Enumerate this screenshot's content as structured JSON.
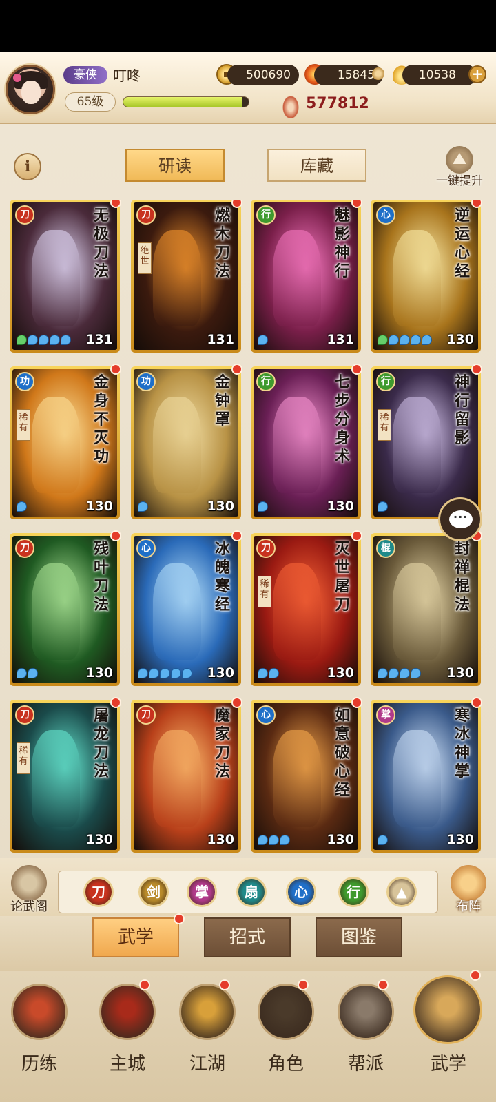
{
  "header": {
    "rank": "豪侠",
    "player_name": "叮咚",
    "level": "65级",
    "exp_fraction": 0.95,
    "copper": "500690",
    "fire": "15845",
    "gold": "10538",
    "power": "577812"
  },
  "subtabs": {
    "study": "研读",
    "storage": "库藏",
    "upgrade_all": "一键提升"
  },
  "info_label": "i",
  "cards": [
    {
      "title": "无极刀法",
      "type": "刀",
      "type_color": "#c8321f",
      "badge": "",
      "level": "131",
      "stars": [
        "green",
        "blue",
        "blue",
        "blue",
        "blue"
      ],
      "bg": "#4a2a3a",
      "accent": "#e9e0ff"
    },
    {
      "title": "燃木刀法",
      "type": "刀",
      "type_color": "#c8321f",
      "badge": "绝世",
      "level": "131",
      "stars": [],
      "bg": "#3b1a0e",
      "accent": "#ff9b2e"
    },
    {
      "title": "魅影神行",
      "type": "行",
      "type_color": "#3f9a2e",
      "badge": "",
      "level": "131",
      "stars": [
        "blue"
      ],
      "bg": "#7a1f4a",
      "accent": "#ff7ec8"
    },
    {
      "title": "逆运心经",
      "type": "心",
      "type_color": "#1f6fc8",
      "badge": "",
      "level": "130",
      "stars": [
        "green",
        "blue",
        "blue",
        "blue",
        "blue"
      ],
      "bg": "#a8741c",
      "accent": "#fff2b0"
    },
    {
      "title": "金身不灭功",
      "type": "功",
      "type_color": "#1f6fc8",
      "badge": "稀有",
      "level": "130",
      "stars": [
        "blue"
      ],
      "bg": "#d0781a",
      "accent": "#ffe6a0"
    },
    {
      "title": "金钟罩",
      "type": "功",
      "type_color": "#1f6fc8",
      "badge": "",
      "level": "130",
      "stars": [
        "blue"
      ],
      "bg": "#b89245",
      "accent": "#f3e0a6"
    },
    {
      "title": "七步分身术",
      "type": "行",
      "type_color": "#3f9a2e",
      "badge": "",
      "level": "130",
      "stars": [
        "blue"
      ],
      "bg": "#6a1f55",
      "accent": "#ff9ad8"
    },
    {
      "title": "神行留影",
      "type": "行",
      "type_color": "#3f9a2e",
      "badge": "稀有",
      "level": "130",
      "stars": [
        "blue"
      ],
      "bg": "#3a2a4a",
      "accent": "#d8c8f0"
    },
    {
      "title": "残叶刀法",
      "type": "刀",
      "type_color": "#c8321f",
      "badge": "",
      "level": "130",
      "stars": [
        "blue",
        "blue"
      ],
      "bg": "#1f5a22",
      "accent": "#b8f0a0"
    },
    {
      "title": "冰魄寒经",
      "type": "心",
      "type_color": "#1f6fc8",
      "badge": "",
      "level": "130",
      "stars": [
        "blue",
        "blue",
        "blue",
        "blue",
        "blue"
      ],
      "bg": "#2a6ab8",
      "accent": "#bfe8ff"
    },
    {
      "title": "灭世屠刀",
      "type": "刀",
      "type_color": "#c8321f",
      "badge": "稀有",
      "level": "130",
      "stars": [
        "blue",
        "blue"
      ],
      "bg": "#9a1a12",
      "accent": "#ff6a3a"
    },
    {
      "title": "封禅棍法",
      "type": "棍",
      "type_color": "#1f8a8a",
      "badge": "",
      "level": "130",
      "stars": [
        "blue",
        "blue",
        "blue",
        "blue"
      ],
      "bg": "#6a5a3a",
      "accent": "#f0e0b0"
    },
    {
      "title": "屠龙刀法",
      "type": "刀",
      "type_color": "#c8321f",
      "badge": "稀有",
      "level": "130",
      "stars": [],
      "bg": "#1a4a4a",
      "accent": "#6af0d8"
    },
    {
      "title": "魔家刀法",
      "type": "刀",
      "type_color": "#c8321f",
      "badge": "",
      "level": "130",
      "stars": [],
      "bg": "#b8401a",
      "accent": "#ffc070"
    },
    {
      "title": "如意破心经",
      "type": "心",
      "type_color": "#1f6fc8",
      "badge": "",
      "level": "130",
      "stars": [
        "blue",
        "blue",
        "blue"
      ],
      "bg": "#5a2a12",
      "accent": "#ffb050"
    },
    {
      "title": "寒冰神掌",
      "type": "掌",
      "type_color": "#b03a8a",
      "badge": "",
      "level": "130",
      "stars": [
        "blue"
      ],
      "bg": "#3a5a8a",
      "accent": "#d8eaff"
    }
  ],
  "filter_bar": {
    "left_button": "论武阁",
    "right_button": "布阵",
    "filters": [
      {
        "glyph": "刀",
        "color": "#c8321f"
      },
      {
        "glyph": "剑",
        "color": "#b88a2a"
      },
      {
        "glyph": "掌",
        "color": "#b03a8a"
      },
      {
        "glyph": "扇",
        "color": "#1f8a8a"
      },
      {
        "glyph": "心",
        "color": "#1f6fc8"
      },
      {
        "glyph": "行",
        "color": "#3f9a2e"
      },
      {
        "glyph": "▲",
        "color": "#d8c49a"
      }
    ]
  },
  "category_tabs": [
    "武学",
    "招式",
    "图鉴"
  ],
  "bottom_nav": [
    {
      "label": "历练",
      "color": "#c94a2a"
    },
    {
      "label": "主城",
      "color": "#a82a1a"
    },
    {
      "label": "江湖",
      "color": "#d8a03a"
    },
    {
      "label": "角色",
      "color": "#4a3a2a"
    },
    {
      "label": "帮派",
      "color": "#8a7a6a"
    },
    {
      "label": "武学",
      "color": "#d8a85a"
    }
  ]
}
